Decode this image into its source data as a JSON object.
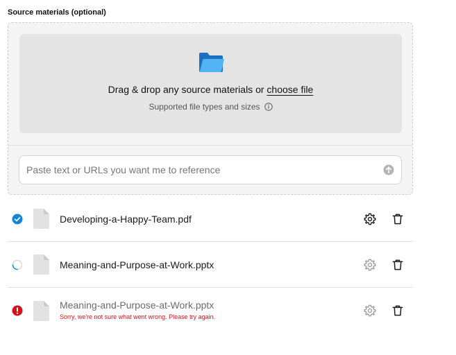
{
  "section": {
    "label": "Source materials (optional)"
  },
  "dropzone": {
    "text_prefix": "Drag & drop any source materials or ",
    "choose_link": "choose file",
    "supported_text": "Supported file types and sizes"
  },
  "paste": {
    "placeholder": "Paste text or URLs you want me to reference"
  },
  "files": [
    {
      "name": "Developing-a-Happy-Team.pdf",
      "status": "complete",
      "error": ""
    },
    {
      "name": "Meaning-and-Purpose-at-Work.pptx",
      "status": "loading",
      "error": ""
    },
    {
      "name": "Meaning-and-Purpose-at-Work.pptx",
      "status": "error",
      "error": "Sorry, we're not sure what went wrong. Please try again."
    }
  ],
  "colors": {
    "accent": "#0f86d8",
    "error": "#d0141a",
    "folder_back": "#1d6fc4",
    "folder_front": "#52b3f3"
  }
}
